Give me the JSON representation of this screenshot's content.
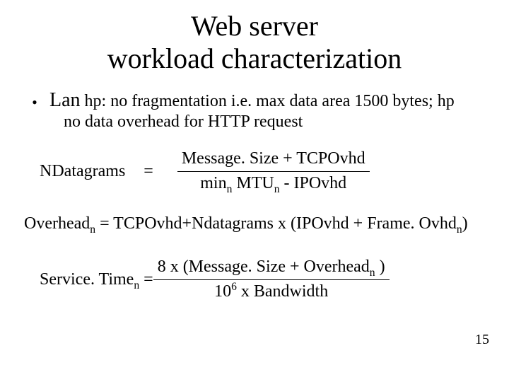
{
  "title_l1": "Web server",
  "title_l2": "workload characterization",
  "bullet_lead": "Lan",
  "bullet_tail": " hp: no fragmentation i.e. max data area 1500 bytes; hp",
  "bullet_line2": "no data overhead for HTTP request",
  "eq1_lhs": "NDatagrams",
  "eq1_eq": "=",
  "eq1_num": "Message. Size + TCPOvhd",
  "eq1_den_pre": "min",
  "eq1_den_sub": "n",
  "eq1_den_mid": " MTU",
  "eq1_den_sub2": "n",
  "eq1_den_post": " - IPOvhd",
  "eq2_a": "Overhead",
  "eq2_a_sub": "n",
  "eq2_rest": " =  TCPOvhd+Ndatagrams x (IPOvhd + Frame. Ovhd",
  "eq2_rest_sub": "n",
  "eq2_close": ")",
  "eq3_lhs_a": "Service. Time",
  "eq3_lhs_sub": "n",
  "eq3_eq": " = ",
  "eq3_num_a": "8 x (Message. Size + Overhead",
  "eq3_num_sub": "n",
  "eq3_num_b": " )",
  "eq3_den_a": "10",
  "eq3_den_sup": "6",
  "eq3_den_b": " x Bandwidth",
  "pagenum": "15"
}
